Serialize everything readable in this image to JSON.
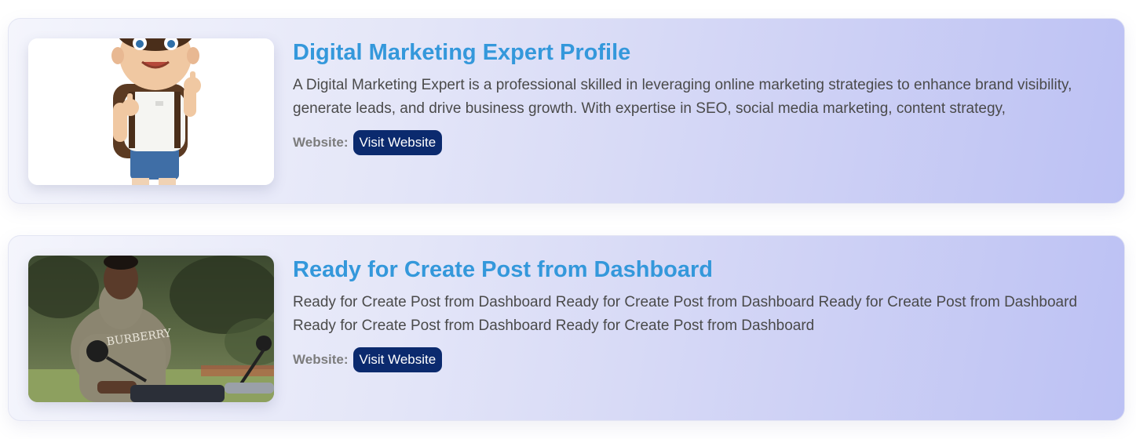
{
  "posts": [
    {
      "title": "Digital Marketing Expert Profile",
      "description": "A Digital Marketing Expert is a professional skilled in leveraging online marketing strategies to enhance brand visibility, generate leads, and drive business growth. With expertise in SEO, social media marketing, content strategy,",
      "website_label": "Website:",
      "button_label": "Visit Website",
      "image": "cartoon-boy-thumbs-up"
    },
    {
      "title": "Ready for Create Post from Dashboard",
      "description": "Ready for Create Post from Dashboard Ready for Create Post from Dashboard Ready for Create Post from Dashboard Ready for Create Post from Dashboard Ready for Create Post from Dashboard",
      "website_label": "Website:",
      "button_label": "Visit Website",
      "image": "man-on-motorcycle-photo"
    }
  ],
  "colors": {
    "title": "#3498db",
    "button_bg": "#0b2a6e",
    "text": "#4a4a4a",
    "label": "#7c7c7c"
  }
}
